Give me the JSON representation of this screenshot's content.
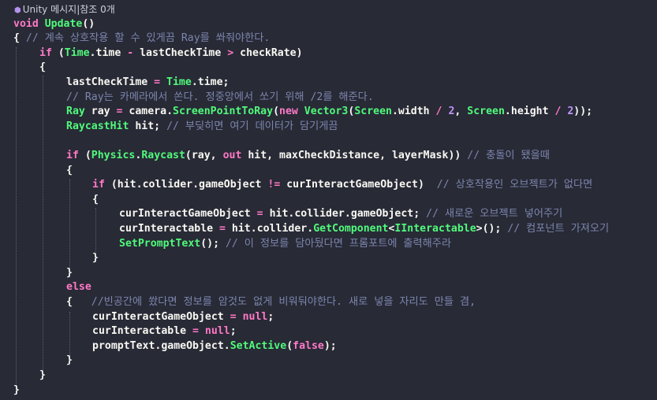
{
  "codelens": {
    "text": "Unity 메시지|참조 0개",
    "icon": "unity-message-icon"
  },
  "colors": {
    "background": "#282a36",
    "keyword": "#ff79c6",
    "function": "#50fa7b",
    "comment": "#7d86ad",
    "number": "#bd93f9",
    "literal": "#ff79c6",
    "text": "#f8f8f2"
  },
  "lines": [
    [
      [
        "kw",
        "void "
      ],
      [
        "fn",
        "Update"
      ],
      [
        "pn",
        "()"
      ]
    ],
    [
      [
        "pn",
        "{ "
      ],
      [
        "cm",
        "// 계속 상호작용 할 수 있게끔 Ray를 쏴줘야한다."
      ]
    ],
    [
      [
        "kw",
        "if "
      ],
      [
        "pn",
        "("
      ],
      [
        "ty",
        "Time"
      ],
      [
        "pn",
        "."
      ],
      [
        "var",
        "time"
      ],
      [
        "op",
        " - "
      ],
      [
        "var",
        "lastCheckTime"
      ],
      [
        "op",
        " > "
      ],
      [
        "var",
        "checkRate"
      ],
      [
        "pn",
        ")"
      ]
    ],
    [
      [
        "pn",
        "{"
      ]
    ],
    [
      [
        "var",
        "lastCheckTime"
      ],
      [
        "op",
        " = "
      ],
      [
        "ty",
        "Time"
      ],
      [
        "pn",
        "."
      ],
      [
        "var",
        "time"
      ],
      [
        "pn",
        ";"
      ]
    ],
    [
      [
        "cm",
        "// Ray는 카메라에서 쏜다. 정중앙에서 쏘기 위해 /2를 해준다."
      ]
    ],
    [
      [
        "ty",
        "Ray "
      ],
      [
        "var",
        "ray"
      ],
      [
        "op",
        " = "
      ],
      [
        "var",
        "camera"
      ],
      [
        "pn",
        "."
      ],
      [
        "fn",
        "ScreenPointToRay"
      ],
      [
        "pn",
        "("
      ],
      [
        "kw",
        "new "
      ],
      [
        "ty",
        "Vector3"
      ],
      [
        "pn",
        "("
      ],
      [
        "ty",
        "Screen"
      ],
      [
        "pn",
        "."
      ],
      [
        "var",
        "width"
      ],
      [
        "op",
        " / "
      ],
      [
        "num",
        "2"
      ],
      [
        "pn",
        ", "
      ],
      [
        "ty",
        "Screen"
      ],
      [
        "pn",
        "."
      ],
      [
        "var",
        "height"
      ],
      [
        "op",
        " / "
      ],
      [
        "num",
        "2"
      ],
      [
        "pn",
        "));"
      ]
    ],
    [
      [
        "ty",
        "RaycastHit "
      ],
      [
        "var",
        "hit"
      ],
      [
        "pn",
        "; "
      ],
      [
        "cm",
        "// 부딪히면 여기 데이터가 담기게끔"
      ]
    ],
    [],
    [
      [
        "kw",
        "if "
      ],
      [
        "pn",
        "("
      ],
      [
        "ty",
        "Physics"
      ],
      [
        "pn",
        "."
      ],
      [
        "fn",
        "Raycast"
      ],
      [
        "pn",
        "("
      ],
      [
        "var",
        "ray"
      ],
      [
        "pn",
        ", "
      ],
      [
        "kw",
        "out "
      ],
      [
        "var",
        "hit"
      ],
      [
        "pn",
        ", "
      ],
      [
        "var",
        "maxCheckDistance"
      ],
      [
        "pn",
        ", "
      ],
      [
        "var",
        "layerMask"
      ],
      [
        "pn",
        "))"
      ],
      [
        "cm",
        " // 충돌이 됐을때"
      ]
    ],
    [
      [
        "pn",
        "{"
      ]
    ],
    [
      [
        "kw",
        "if "
      ],
      [
        "pn",
        "("
      ],
      [
        "var",
        "hit"
      ],
      [
        "pn",
        "."
      ],
      [
        "var",
        "collider"
      ],
      [
        "pn",
        "."
      ],
      [
        "var",
        "gameObject"
      ],
      [
        "op",
        " != "
      ],
      [
        "var",
        "curInteractGameObject"
      ],
      [
        "pn",
        ")"
      ],
      [
        "cm",
        "  // 상호작용인 오브젝트가 없다면"
      ]
    ],
    [
      [
        "pn",
        "{"
      ]
    ],
    [
      [
        "var",
        "curInteractGameObject"
      ],
      [
        "op",
        " = "
      ],
      [
        "var",
        "hit"
      ],
      [
        "pn",
        "."
      ],
      [
        "var",
        "collider"
      ],
      [
        "pn",
        "."
      ],
      [
        "var",
        "gameObject"
      ],
      [
        "pn",
        "; "
      ],
      [
        "cm",
        "// 새로운 오브젝트 넣어주기"
      ]
    ],
    [
      [
        "var",
        "curInteractable"
      ],
      [
        "op",
        " = "
      ],
      [
        "var",
        "hit"
      ],
      [
        "pn",
        "."
      ],
      [
        "var",
        "collider"
      ],
      [
        "pn",
        "."
      ],
      [
        "fn",
        "GetComponent"
      ],
      [
        "pn",
        "<"
      ],
      [
        "ty",
        "IInteractable"
      ],
      [
        "pn",
        ">(); "
      ],
      [
        "cm",
        "// 컴포넌트 가져오기"
      ]
    ],
    [
      [
        "fn",
        "SetPromptText"
      ],
      [
        "pn",
        "(); "
      ],
      [
        "cm",
        "// 이 정보를 담아뒀다면 프롬포트에 출력해주라"
      ]
    ],
    [
      [
        "pn",
        "}"
      ]
    ],
    [
      [
        "pn",
        "}"
      ]
    ],
    [
      [
        "kw",
        "else"
      ]
    ],
    [
      [
        "pn",
        "{   "
      ],
      [
        "cm",
        "//빈공간에 쐈다면 정보를 암것도 없게 비워둬야한다. 새로 넣을 자리도 만들 겸,"
      ]
    ],
    [
      [
        "var",
        "curInteractGameObject"
      ],
      [
        "op",
        " = "
      ],
      [
        "kw",
        "null"
      ],
      [
        "pn",
        ";"
      ]
    ],
    [
      [
        "var",
        "curInteractable"
      ],
      [
        "op",
        " = "
      ],
      [
        "kw",
        "null"
      ],
      [
        "pn",
        ";"
      ]
    ],
    [
      [
        "var",
        "promptText"
      ],
      [
        "pn",
        "."
      ],
      [
        "var",
        "gameObject"
      ],
      [
        "pn",
        "."
      ],
      [
        "fn",
        "SetActive"
      ],
      [
        "pn",
        "("
      ],
      [
        "kw",
        "false"
      ],
      [
        "pn",
        ");"
      ]
    ],
    [
      [
        "pn",
        "}"
      ]
    ],
    [
      [
        "pn",
        "}"
      ]
    ],
    [
      [
        "pn",
        "}"
      ]
    ]
  ]
}
